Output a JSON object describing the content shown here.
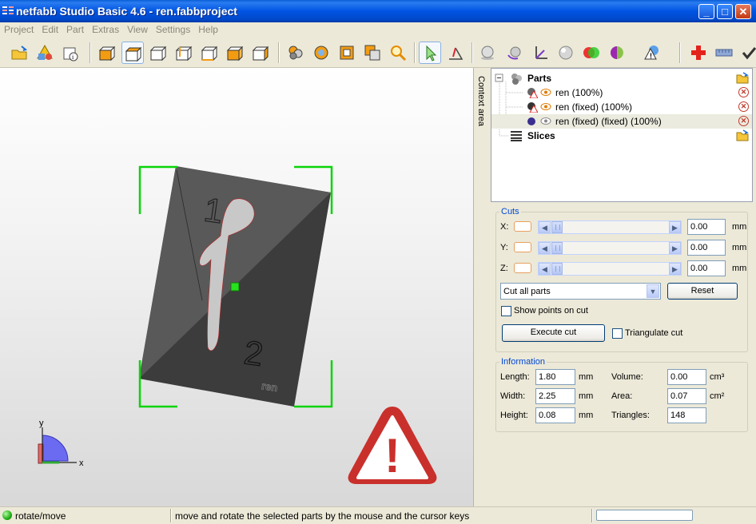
{
  "window": {
    "title": "netfabb Studio Basic 4.6 - ren.fabbproject",
    "minimize_label": "_",
    "maximize_label": "□",
    "close_label": "✕"
  },
  "menu": {
    "items": [
      "Project",
      "Edit",
      "Part",
      "Extras",
      "View",
      "Settings",
      "Help"
    ]
  },
  "toolbar": {
    "icons": [
      "open-project-icon",
      "add-part-icon",
      "project-info-icon",
      "view-front-icon",
      "view-top-icon",
      "view-back-icon",
      "view-left-icon",
      "view-right-icon",
      "view-bottom-icon",
      "view-perspective-icon",
      "zoom-all-icon",
      "zoom-selection-icon",
      "zoom-box-icon",
      "zoom-part-icon",
      "zoom-icon",
      "select-pointer-icon",
      "measure-icon",
      "shading-icon",
      "rotate-icon",
      "axes-icon",
      "sphere-icon",
      "color-icon",
      "repair-icon",
      "warning-icon",
      "add-part-red-icon",
      "ruler-icon",
      "check-icon"
    ],
    "active_index": 15
  },
  "viewport": {
    "axis_y_label": "y",
    "axis_x_label": "x",
    "part_label_1": "1",
    "part_label_2": "2",
    "part_engraving": "ren",
    "warning_glyph": "!"
  },
  "context_area": {
    "label": "Context area"
  },
  "tree": {
    "root": {
      "label": "Parts"
    },
    "parts": [
      {
        "label": "ren (100%)",
        "icon": "part-warning-icon",
        "visible": true
      },
      {
        "label": "ren (fixed) (100%)",
        "icon": "part-warning-icon",
        "visible": true
      },
      {
        "label": "ren (fixed) (fixed) (100%)",
        "icon": "part-ok-icon",
        "visible": false,
        "selected": true
      }
    ],
    "slices": {
      "label": "Slices"
    }
  },
  "cuts": {
    "legend": "Cuts",
    "axes": [
      {
        "label": "X:",
        "value": "0.00",
        "unit": "mm"
      },
      {
        "label": "Y:",
        "value": "0.00",
        "unit": "mm"
      },
      {
        "label": "Z:",
        "value": "0.00",
        "unit": "mm"
      }
    ],
    "scope_select": "Cut all parts",
    "reset_label": "Reset",
    "show_points_label": "Show points on cut",
    "show_points_checked": false,
    "execute_label": "Execute cut",
    "triangulate_label": "Triangulate cut",
    "triangulate_checked": false
  },
  "information": {
    "legend": "Information",
    "length": {
      "label": "Length:",
      "value": "1.80",
      "unit": "mm"
    },
    "width": {
      "label": "Width:",
      "value": "2.25",
      "unit": "mm"
    },
    "height": {
      "label": "Height:",
      "value": "0.08",
      "unit": "mm"
    },
    "volume": {
      "label": "Volume:",
      "value": "0.00",
      "unit": "cm³"
    },
    "area": {
      "label": "Area:",
      "value": "0.07",
      "unit": "cm²"
    },
    "triangles": {
      "label": "Triangles:",
      "value": "148"
    }
  },
  "statusbar": {
    "mode": "rotate/move",
    "message": "move and rotate the selected parts by the mouse and the cursor keys"
  }
}
